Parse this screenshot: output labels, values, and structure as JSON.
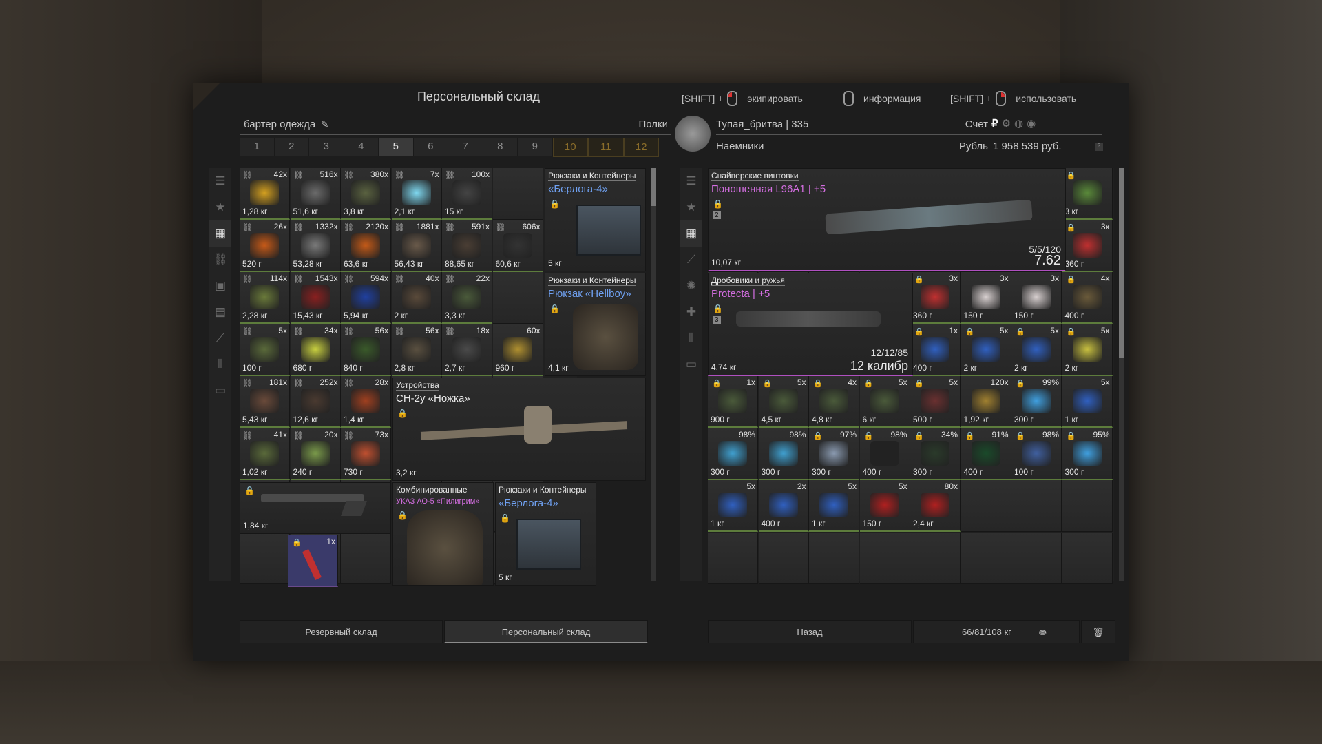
{
  "window": {
    "title": "Персональный склад"
  },
  "hints": {
    "shift1": "[SHIFT] +",
    "equip": "экипировать",
    "info": "информация",
    "shift2": "[SHIFT] +",
    "use": "использовать"
  },
  "left": {
    "filter_label": "бартер одежда",
    "shelves_label": "Полки",
    "tabs": [
      "1",
      "2",
      "3",
      "4",
      "5",
      "6",
      "7",
      "8",
      "9",
      "10",
      "11",
      "12"
    ],
    "active_tab": "5",
    "small_cells": [
      {
        "c": 0,
        "r": 0,
        "cnt": "42x",
        "wt": "1,28 кг",
        "color": "#d4a020",
        "chain": true
      },
      {
        "c": 1,
        "r": 0,
        "cnt": "516x",
        "wt": "51,6 кг",
        "color": "#6b6b6b",
        "chain": true
      },
      {
        "c": 2,
        "r": 0,
        "cnt": "380x",
        "wt": "3,8 кг",
        "color": "#5a6240",
        "chain": true
      },
      {
        "c": 3,
        "r": 0,
        "cnt": "7x",
        "wt": "2,1 кг",
        "color": "#7fd8f0",
        "chain": true
      },
      {
        "c": 4,
        "r": 0,
        "cnt": "100x",
        "wt": "15 кг",
        "color": "#444",
        "chain": true
      },
      {
        "c": 0,
        "r": 1,
        "cnt": "26x",
        "wt": "520 г",
        "color": "#c75a18",
        "chain": true
      },
      {
        "c": 1,
        "r": 1,
        "cnt": "1332x",
        "wt": "53,28 кг",
        "color": "#7a7a7a",
        "chain": true
      },
      {
        "c": 2,
        "r": 1,
        "cnt": "2120x",
        "wt": "63,6 кг",
        "color": "#c45a18",
        "chain": true
      },
      {
        "c": 3,
        "r": 1,
        "cnt": "1881x",
        "wt": "56,43 кг",
        "color": "#6a5a4a",
        "chain": true
      },
      {
        "c": 4,
        "r": 1,
        "cnt": "591x",
        "wt": "88,65 кг",
        "color": "#4a3e34",
        "chain": true
      },
      {
        "c": 5,
        "r": 1,
        "cnt": "606x",
        "wt": "60,6 кг",
        "color": "#333",
        "chain": true
      },
      {
        "c": 0,
        "r": 2,
        "cnt": "114x",
        "wt": "2,28 кг",
        "color": "#6a7a3a",
        "chain": true
      },
      {
        "c": 1,
        "r": 2,
        "cnt": "1543x",
        "wt": "15,43 кг",
        "color": "#8a2020",
        "chain": true
      },
      {
        "c": 2,
        "r": 2,
        "cnt": "594x",
        "wt": "5,94 кг",
        "color": "#2040a0",
        "chain": true
      },
      {
        "c": 3,
        "r": 2,
        "cnt": "40x",
        "wt": "2 кг",
        "color": "#5a4a3a",
        "chain": true
      },
      {
        "c": 4,
        "r": 2,
        "cnt": "22x",
        "wt": "3,3 кг",
        "color": "#4a5a3a",
        "chain": true
      },
      {
        "c": 0,
        "r": 3,
        "cnt": "5x",
        "wt": "100 г",
        "color": "#5a6a3a",
        "chain": true
      },
      {
        "c": 1,
        "r": 3,
        "cnt": "34x",
        "wt": "680 г",
        "color": "#c8d040",
        "chain": true
      },
      {
        "c": 2,
        "r": 3,
        "cnt": "56x",
        "wt": "840 г",
        "color": "#3a5a2a",
        "chain": true
      },
      {
        "c": 3,
        "r": 3,
        "cnt": "56x",
        "wt": "2,8 кг",
        "color": "#5a5040",
        "chain": true
      },
      {
        "c": 4,
        "r": 3,
        "cnt": "18x",
        "wt": "2,7 кг",
        "color": "#4a4a4a",
        "chain": true
      },
      {
        "c": 5,
        "r": 3,
        "cnt": "60x",
        "wt": "960 г",
        "color": "#b09030",
        "chain": false
      },
      {
        "c": 0,
        "r": 4,
        "cnt": "181x",
        "wt": "5,43 кг",
        "color": "#6a4a3a",
        "chain": true
      },
      {
        "c": 1,
        "r": 4,
        "cnt": "252x",
        "wt": "12,6 кг",
        "color": "#4a3a30",
        "chain": true
      },
      {
        "c": 2,
        "r": 4,
        "cnt": "28x",
        "wt": "1,4 кг",
        "color": "#a04020",
        "chain": true
      },
      {
        "c": 0,
        "r": 5,
        "cnt": "41x",
        "wt": "1,02 кг",
        "color": "#5a6a3a",
        "chain": true
      },
      {
        "c": 1,
        "r": 5,
        "cnt": "20x",
        "wt": "240 г",
        "color": "#7a9a4a",
        "chain": true
      },
      {
        "c": 2,
        "r": 5,
        "cnt": "73x",
        "wt": "730 г",
        "color": "#c05030",
        "chain": true
      }
    ],
    "backpack1": {
      "cat": "Рюкзаки и Контейнеры",
      "name": "«Берлога-4»",
      "wt": "5 кг"
    },
    "backpack2": {
      "cat": "Рюкзаки и Контейнеры",
      "name": "Рюкзак «Hellboy»",
      "wt": "4,1 кг"
    },
    "device": {
      "cat": "Устройства",
      "name": "СН-2у «Ножка»",
      "wt": "3,2 кг"
    },
    "shotgun": {
      "wt": "1,84 кг"
    },
    "knife": {
      "cnt": "1x"
    },
    "armor": {
      "cat": "Комбинированные",
      "name": "УКАЗ АО-5 «Пилигрим»"
    },
    "backpack3": {
      "cat": "Рюкзаки и Контейнеры",
      "name": "«Берлога-4»",
      "wt": "5 кг"
    },
    "btn_reserve": "Резервный склад",
    "btn_personal": "Персональный склад"
  },
  "right": {
    "player": "Тупая_бритва | 335",
    "account_label": "Счет",
    "group": "Наемники",
    "currency_label": "Рубль",
    "money": "1 958 539 руб.",
    "rifle": {
      "cat": "Снайперские винтовки",
      "name": "Поношенная L96A1 | +5",
      "wt": "10,07 кг",
      "ammo": "5/5/120",
      "caliber": "7.62"
    },
    "shotgun": {
      "cat": "Дробовики и ружья",
      "name": "Protecta | +5",
      "wt": "4,74 кг",
      "ammo": "12/12/85",
      "caliber": "12 калибр"
    },
    "cells": [
      {
        "c": 7,
        "r": 0,
        "cnt": "",
        "wt": "3 кг",
        "color": "#5a8a3a",
        "lock": true
      },
      {
        "c": 7,
        "r": 1,
        "cnt": "3x",
        "wt": "360 г",
        "color": "#c03030",
        "lock": true
      },
      {
        "c": 4,
        "r": 2,
        "cnt": "3x",
        "wt": "360 г",
        "color": "#c03030",
        "lock": true
      },
      {
        "c": 5,
        "r": 2,
        "cnt": "3x",
        "wt": "150 г",
        "color": "#d8d0d0",
        "lock": false
      },
      {
        "c": 6,
        "r": 2,
        "cnt": "3x",
        "wt": "150 г",
        "color": "#d8d0d0",
        "lock": false
      },
      {
        "c": 7,
        "r": 2,
        "cnt": "4x",
        "wt": "400 г",
        "color": "#6a5a3a",
        "lock": true
      },
      {
        "c": 4,
        "r": 3,
        "cnt": "1x",
        "wt": "400 г",
        "color": "#3060c0",
        "lock": true
      },
      {
        "c": 5,
        "r": 3,
        "cnt": "5x",
        "wt": "2 кг",
        "color": "#3060c0",
        "lock": true
      },
      {
        "c": 6,
        "r": 3,
        "cnt": "5x",
        "wt": "2 кг",
        "color": "#3060c0",
        "lock": true
      },
      {
        "c": 7,
        "r": 3,
        "cnt": "5x",
        "wt": "2 кг",
        "color": "#c8c040",
        "lock": true
      },
      {
        "c": 0,
        "r": 4,
        "cnt": "1x",
        "wt": "900 г",
        "color": "#4a5a3a",
        "lock": true
      },
      {
        "c": 1,
        "r": 4,
        "cnt": "5x",
        "wt": "4,5 кг",
        "color": "#4a5a3a",
        "lock": true
      },
      {
        "c": 2,
        "r": 4,
        "cnt": "4x",
        "wt": "4,8 кг",
        "color": "#4a5a3a",
        "lock": true
      },
      {
        "c": 3,
        "r": 4,
        "cnt": "5x",
        "wt": "6 кг",
        "color": "#4a5a3a",
        "lock": true
      },
      {
        "c": 4,
        "r": 4,
        "cnt": "5x",
        "wt": "500 г",
        "color": "#6a3030",
        "lock": true
      },
      {
        "c": 5,
        "r": 4,
        "cnt": "120x",
        "wt": "1,92 кг",
        "color": "#a08030",
        "lock": false
      },
      {
        "c": 6,
        "r": 4,
        "cnt": "99%",
        "wt": "300 г",
        "color": "#40a0e0",
        "lock": true
      },
      {
        "c": 7,
        "r": 4,
        "cnt": "5x",
        "wt": "1 кг",
        "color": "#3060c0",
        "lock": false
      },
      {
        "c": 0,
        "r": 5,
        "cnt": "98%",
        "wt": "300 г",
        "color": "#40a0d0",
        "lock": false
      },
      {
        "c": 1,
        "r": 5,
        "cnt": "98%",
        "wt": "300 г",
        "color": "#40a0d0",
        "lock": false
      },
      {
        "c": 2,
        "r": 5,
        "cnt": "97%",
        "wt": "300 г",
        "color": "#8a9ab0",
        "lock": true
      },
      {
        "c": 3,
        "r": 5,
        "cnt": "98%",
        "wt": "400 г",
        "color": "#222",
        "lock": true
      },
      {
        "c": 4,
        "r": 5,
        "cnt": "34%",
        "wt": "300 г",
        "color": "#2a3a2a",
        "lock": true
      },
      {
        "c": 5,
        "r": 5,
        "cnt": "91%",
        "wt": "400 г",
        "color": "#1a4a2a",
        "lock": true
      },
      {
        "c": 6,
        "r": 5,
        "cnt": "98%",
        "wt": "100 г",
        "color": "#4060a0",
        "lock": true
      },
      {
        "c": 7,
        "r": 5,
        "cnt": "95%",
        "wt": "300 г",
        "color": "#40a0e0",
        "lock": true
      },
      {
        "c": 0,
        "r": 6,
        "cnt": "5x",
        "wt": "1 кг",
        "color": "#3060c0",
        "lock": false
      },
      {
        "c": 1,
        "r": 6,
        "cnt": "2x",
        "wt": "400 г",
        "color": "#3060c0",
        "lock": false
      },
      {
        "c": 2,
        "r": 6,
        "cnt": "5x",
        "wt": "1 кг",
        "color": "#3060c0",
        "lock": false
      },
      {
        "c": 3,
        "r": 6,
        "cnt": "5x",
        "wt": "150 г",
        "color": "#b02020",
        "lock": false
      },
      {
        "c": 4,
        "r": 6,
        "cnt": "80x",
        "wt": "2,4 кг",
        "color": "#b02020",
        "lock": false
      }
    ],
    "btn_back": "Назад",
    "weight": "66/81/108 кг"
  }
}
